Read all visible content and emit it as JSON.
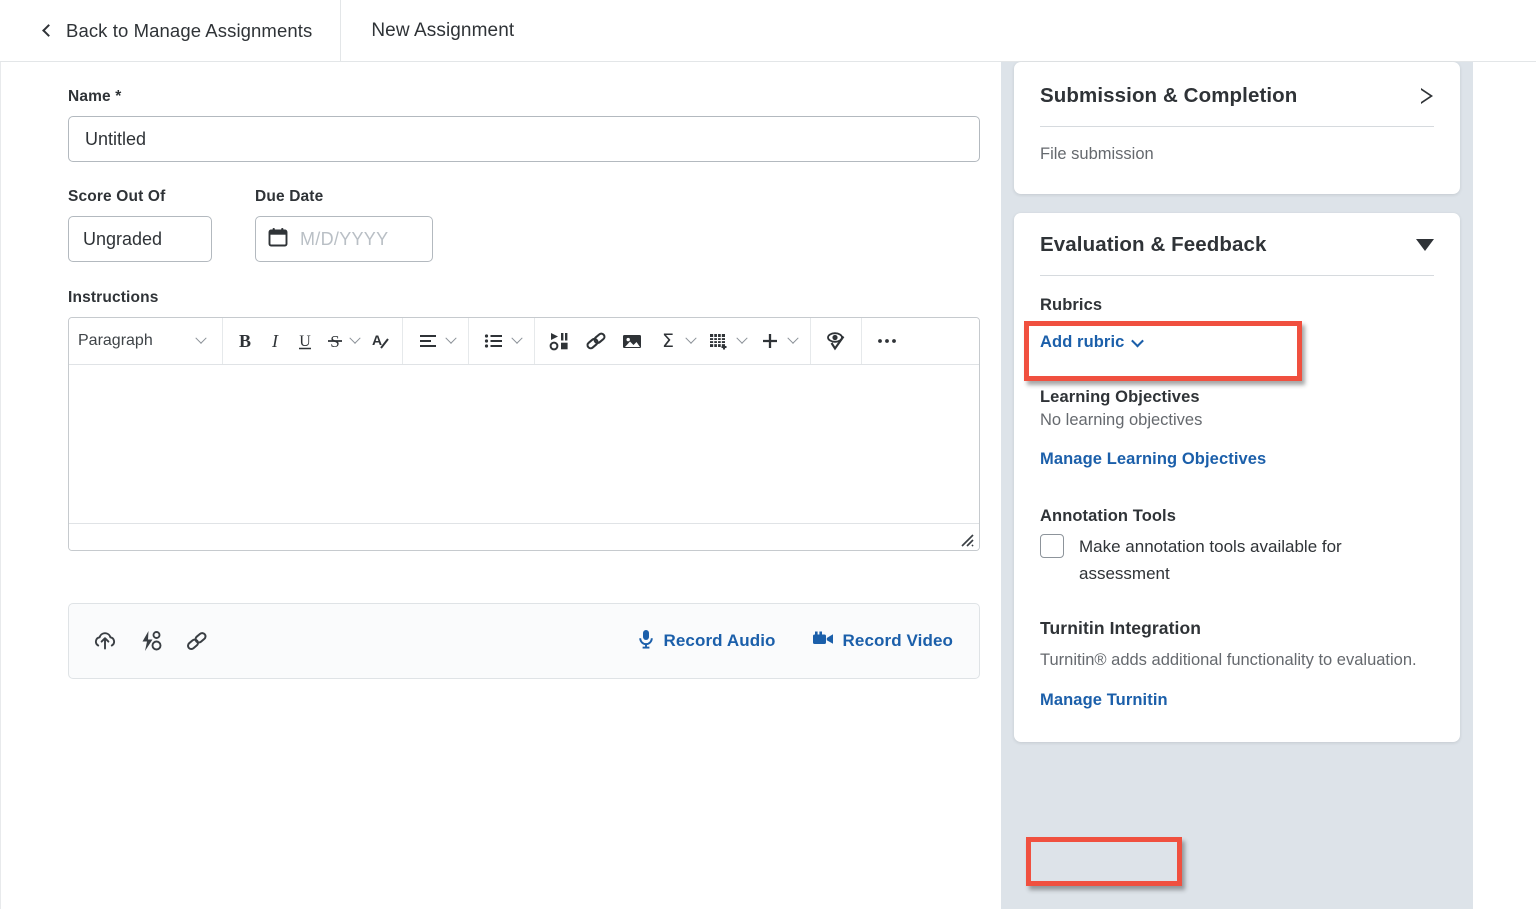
{
  "header": {
    "back_label": "Back to Manage Assignments",
    "back_icon": "chevron-left-icon",
    "page_title": "New Assignment"
  },
  "form": {
    "name": {
      "label": "Name *",
      "value": "Untitled",
      "placeholder": ""
    },
    "score_out_of": {
      "label": "Score Out Of",
      "value": "Ungraded",
      "placeholder": ""
    },
    "due_date": {
      "label": "Due Date",
      "value": "",
      "placeholder": "M/D/YYYY",
      "icon": "calendar-icon"
    },
    "instructions": {
      "label": "Instructions",
      "value": "",
      "toolbar": {
        "paragraph_style": "Paragraph",
        "buttons": [
          {
            "name": "bold",
            "glyph": "B"
          },
          {
            "name": "italic",
            "glyph": "I"
          },
          {
            "name": "underline",
            "glyph": "U"
          },
          {
            "name": "strikethrough",
            "glyph": "S"
          },
          {
            "name": "text-color",
            "glyph": "A"
          },
          {
            "name": "align",
            "glyph": "align"
          },
          {
            "name": "list",
            "glyph": "list"
          },
          {
            "name": "insert-media",
            "glyph": "media"
          },
          {
            "name": "quicklink",
            "glyph": "link"
          },
          {
            "name": "insert-image",
            "glyph": "image"
          },
          {
            "name": "equation",
            "glyph": "sigma"
          },
          {
            "name": "insert-table",
            "glyph": "table"
          },
          {
            "name": "insert-more",
            "glyph": "plus"
          },
          {
            "name": "accessibility-check",
            "glyph": "eye-check"
          },
          {
            "name": "more-options",
            "glyph": "ellipsis"
          }
        ]
      }
    }
  },
  "attachments": {
    "icons": [
      {
        "name": "upload-icon",
        "title": "Add a File"
      },
      {
        "name": "quicklink-icon",
        "title": "Add Quicklink"
      },
      {
        "name": "link-icon",
        "title": "Add a Link"
      }
    ],
    "record_audio": "Record Audio",
    "record_audio_icon": "microphone-icon",
    "record_video": "Record Video",
    "record_video_icon": "video-camera-icon"
  },
  "right_panel": {
    "submission_card": {
      "title": "Submission & Completion",
      "toggle_icon": "triangle-right-icon",
      "summary": "File submission"
    },
    "evaluation_card": {
      "title": "Evaluation & Feedback",
      "toggle_icon": "triangle-down-icon",
      "rubrics": {
        "heading": "Rubrics",
        "add_link": "Add rubric",
        "add_link_icon": "chevron-down-icon"
      },
      "learning_objectives": {
        "heading": "Learning Objectives",
        "empty_text": "No learning objectives",
        "manage_link": "Manage Learning Objectives"
      },
      "annotation_tools": {
        "heading": "Annotation Tools",
        "checkbox_label": "Make annotation tools available for assessment",
        "checked": false
      },
      "turnitin": {
        "heading": "Turnitin Integration",
        "description": "Turnitin® adds additional functionality to evaluation.",
        "manage_link": "Manage Turnitin"
      }
    }
  },
  "annotations": {
    "highlight_color": "#f0503f",
    "boxes": [
      {
        "name": "evaluation-feedback-highlight",
        "target": "Evaluation & Feedback"
      },
      {
        "name": "manage-turnitin-highlight",
        "target": "Manage Turnitin"
      }
    ]
  },
  "colors": {
    "link_blue": "#1b5faa",
    "text_dark": "#2f3337",
    "rail_background": "#dde3e9"
  }
}
